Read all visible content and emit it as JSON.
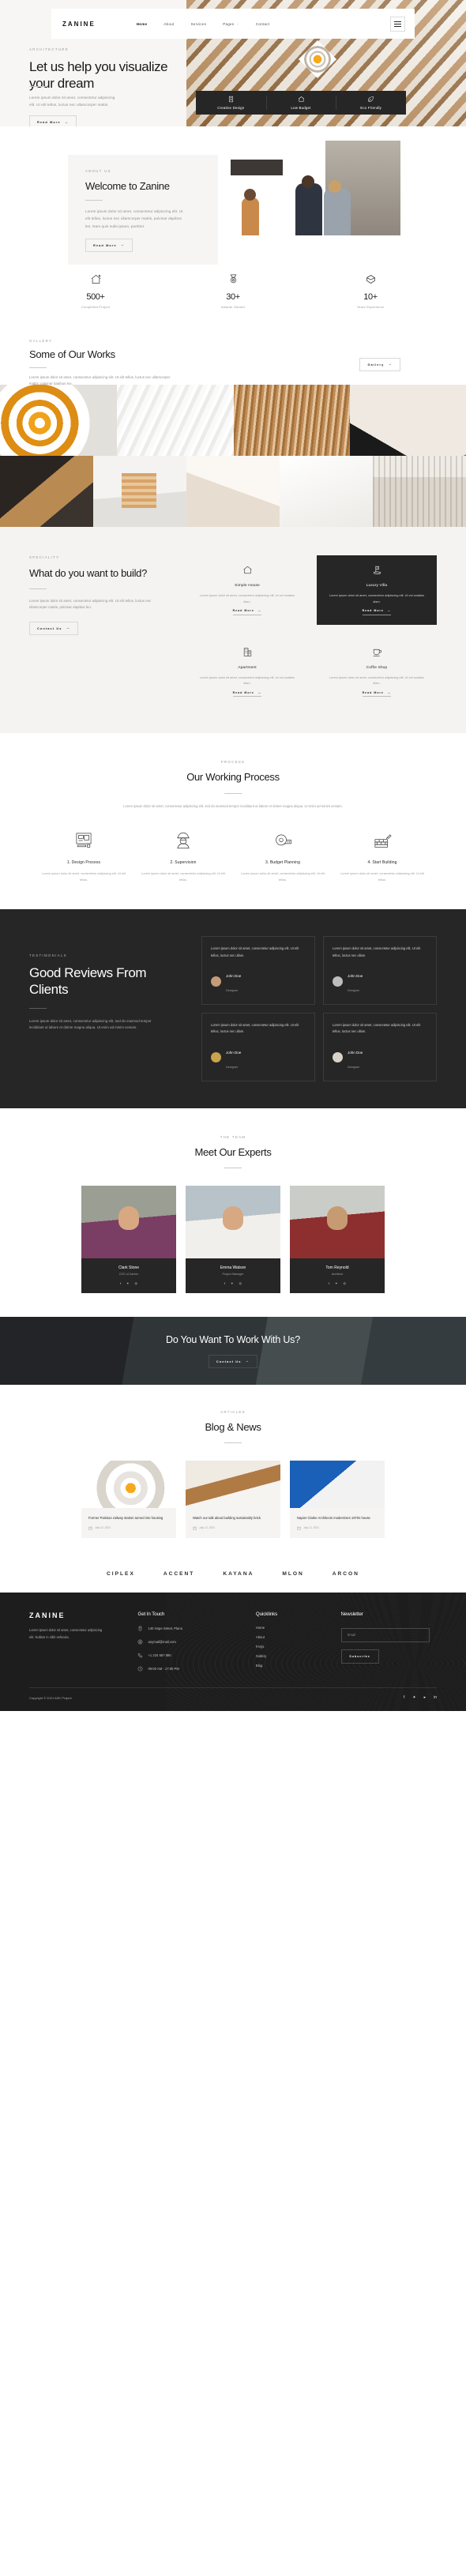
{
  "brand": {
    "name": "ZANINE"
  },
  "nav": {
    "items": [
      {
        "label": "Home",
        "active": true,
        "caret": false
      },
      {
        "label": "About",
        "active": false,
        "caret": false
      },
      {
        "label": "Services",
        "active": false,
        "caret": false
      },
      {
        "label": "Pages",
        "active": false,
        "caret": true
      },
      {
        "label": "Contact",
        "active": false,
        "caret": false
      }
    ],
    "menu_icon": "hamburger-icon"
  },
  "hero": {
    "eyebrow": "ARCHITECTURE",
    "title": "Let us help you visualize your dream",
    "paragraph": "Lorem ipsum dolor sit amet, consectetur adipiscing elit. Ut elit tellus, luctus nec ullamcorper mattis.",
    "cta": "Read More",
    "arrow": "→",
    "features": [
      {
        "icon": "building-icon",
        "label": "Creative Design"
      },
      {
        "icon": "home-icon",
        "label": "Low Budget"
      },
      {
        "icon": "leaf-icon",
        "label": "Eco Friendly"
      }
    ]
  },
  "about": {
    "eyebrow": "ABOUT US",
    "title": "Welcome to Zanine",
    "paragraph": "Lorem ipsum dolor sit amet, consectetur adipiscing elit. Ut elit tellus, luctus nec ullamcorper mattis, pulvinar dapibus leo. Nam quis nulla ipsum, porttitor.",
    "cta": "Read More",
    "arrow": "→"
  },
  "stats": [
    {
      "icon": "house-icon",
      "value": "500+",
      "caption": "Completed Project"
    },
    {
      "icon": "medal-icon",
      "value": "30+",
      "caption": "Awards Gained"
    },
    {
      "icon": "diamond-icon",
      "value": "10+",
      "caption": "Years Experience"
    }
  ],
  "gallery": {
    "eyebrow": "GALLERY",
    "title": "Some of Our Works",
    "paragraph": "Lorem ipsum dolor sit amet, consectetur adipiscing elit. Ut elit tellus, luctus nec ullamcorper mattis, pulvinar dapibus leo.",
    "button": "Gallery",
    "arrow": "→",
    "row1": [
      "spiral-staircase",
      "white-facade",
      "wood-ceiling",
      "curved-wall"
    ],
    "row2": [
      "dark-interior",
      "stair-detail",
      "ramp-detail",
      "atrium-hall",
      "pale-room"
    ]
  },
  "speciality": {
    "eyebrow": "SPECIALITY",
    "title": "What do you want to build?",
    "paragraph": "Lorem ipsum dolor sit amet, consectetur adipiscing elit. Ut elit tellus, luctus nec ullamcorper mattis, pulvinar dapibus leo.",
    "button": "Contact Us",
    "arrow": "→",
    "cards": [
      {
        "icon": "home-icon",
        "title": "Simple House",
        "text": "Lorem ipsum dolor sit amet, consectetur adipiscing elit. Ut vel sodales diam.",
        "link": "Read More",
        "active": false
      },
      {
        "icon": "flag-icon",
        "title": "Luxury Villa",
        "text": "Lorem ipsum dolor sit amet, consectetur adipiscing elit. Ut vel sodales diam.",
        "link": "Read More",
        "active": true
      },
      {
        "icon": "office-icon",
        "title": "Apartment",
        "text": "Lorem ipsum dolor sit amet, consectetur adipiscing elit. Ut vel sodales diam.",
        "link": "Read More",
        "active": false
      },
      {
        "icon": "cup-icon",
        "title": "Coffie Shop",
        "text": "Lorem ipsum dolor sit amet, consectetur adipiscing elit. Ut vel sodales diam.",
        "link": "Read More",
        "active": false
      }
    ]
  },
  "process": {
    "eyebrow": "PROCESS",
    "title": "Our Working Process",
    "paragraph": "Lorem ipsum dolor sit amet, consectetur adipiscing elit, sed do eiusmod tempor incididunt ut labore et dolore magna aliqua. Ut enim ad minim veniam.",
    "steps": [
      {
        "icon": "blueprint-icon",
        "title": "1. Design Process",
        "text": "Lorem ipsum dolor sit amet, consectetur adipiscing elit. Ut elit tellus."
      },
      {
        "icon": "worker-icon",
        "title": "2. Supervision",
        "text": "Lorem ipsum dolor sit amet, consectetur adipiscing elit. Ut elit tellus."
      },
      {
        "icon": "tape-measure-icon",
        "title": "3. Budget Planning",
        "text": "Lorem ipsum dolor sit amet, consectetur adipiscing elit. Ut elit tellus."
      },
      {
        "icon": "brick-wall-icon",
        "title": "4. Start Building",
        "text": "Lorem ipsum dolor sit amet, consectetur adipiscing elit. Ut elit tellus."
      }
    ]
  },
  "testimonials": {
    "eyebrow": "TESTIMONIALS",
    "title": "Good Reviews From Clients",
    "paragraph": "Lorem ipsum dolor sit amet, consectetur adipiscing elit, sed do eiusmod tempor incididunt ut labore et dolore magna aliqua. Ut enim ad minim veniam.",
    "cards": [
      {
        "quote": "Lorem ipsum dolor sit amet, consectetur adipiscing elit. Ut elit tellus, luctus nec ullam.",
        "name": "John Doe",
        "role": "Designer"
      },
      {
        "quote": "Lorem ipsum dolor sit amet, consectetur adipiscing elit. Ut elit tellus, luctus nec ullam.",
        "name": "John Doe",
        "role": "Designer"
      },
      {
        "quote": "Lorem ipsum dolor sit amet, consectetur adipiscing elit. Ut elit tellus, luctus nec ullam.",
        "name": "John Doe",
        "role": "Designer"
      },
      {
        "quote": "Lorem ipsum dolor sit amet, consectetur adipiscing elit. Ut elit tellus, luctus nec ullam.",
        "name": "John Doe",
        "role": "Designer"
      }
    ]
  },
  "team": {
    "eyebrow": "THE TEAM",
    "title": "Meet Our Experts",
    "members": [
      {
        "name": "Clark Stone",
        "role": "CEO of Zanine",
        "socials": [
          "facebook-icon",
          "twitter-icon",
          "instagram-icon"
        ]
      },
      {
        "name": "Emma Watson",
        "role": "Project Manager",
        "socials": [
          "facebook-icon",
          "twitter-icon",
          "instagram-icon"
        ]
      },
      {
        "name": "Tom Reynold",
        "role": "Architect",
        "socials": [
          "facebook-icon",
          "twitter-icon",
          "instagram-icon"
        ]
      }
    ]
  },
  "cta": {
    "title": "Do You Want To Work With Us?",
    "button": "Contact Us",
    "arrow": "→"
  },
  "blog": {
    "eyebrow": "ARTICLES",
    "title": "Blog & News",
    "posts": [
      {
        "title": "Former Parisian railway station turned into housing",
        "date": "July 12, 2021",
        "thumb": "spiral-photo"
      },
      {
        "title": "Watch our talk about building sustainably brick",
        "date": "July 12, 2021",
        "thumb": "window-photo"
      },
      {
        "title": "Napier Clarke Architects modernises 1970s house",
        "date": "July 12, 2021",
        "thumb": "blue-photo"
      }
    ]
  },
  "brands": [
    "CIPLEX",
    "ACCENT",
    "KAYANA",
    "MLON",
    "ARCON"
  ],
  "footer": {
    "logo": "ZANINE",
    "about": "Lorem ipsum dolor sit amet, consectetur adipiscing elit. Nullam in nibh vehicula.",
    "contact_title": "Get In Touch",
    "contact": [
      {
        "icon": "map-pin-icon",
        "text": "140 Hope Street, Plano"
      },
      {
        "icon": "mail-icon",
        "text": "anymail@mail.com"
      },
      {
        "icon": "phone-icon",
        "text": "+1 234 567 890"
      },
      {
        "icon": "clock-icon",
        "text": "09:00 AM - 17:00 PM"
      }
    ],
    "quicklinks_title": "Quicklinks",
    "quicklinks": [
      "Home",
      "About",
      "FAQs",
      "Gallery",
      "Blog"
    ],
    "newsletter_title": "Newsletter",
    "email_placeholder": "Email",
    "email_value": "",
    "subscribe": "Subscribe",
    "copyright": "Copyright © 2021 ASK Project",
    "socials": [
      "facebook-icon",
      "twitter-icon",
      "youtube-icon",
      "linkedin-icon"
    ]
  },
  "colors": {
    "dark": "#262626",
    "accent": "#f0a31a",
    "footer": "#1d1d1d"
  }
}
